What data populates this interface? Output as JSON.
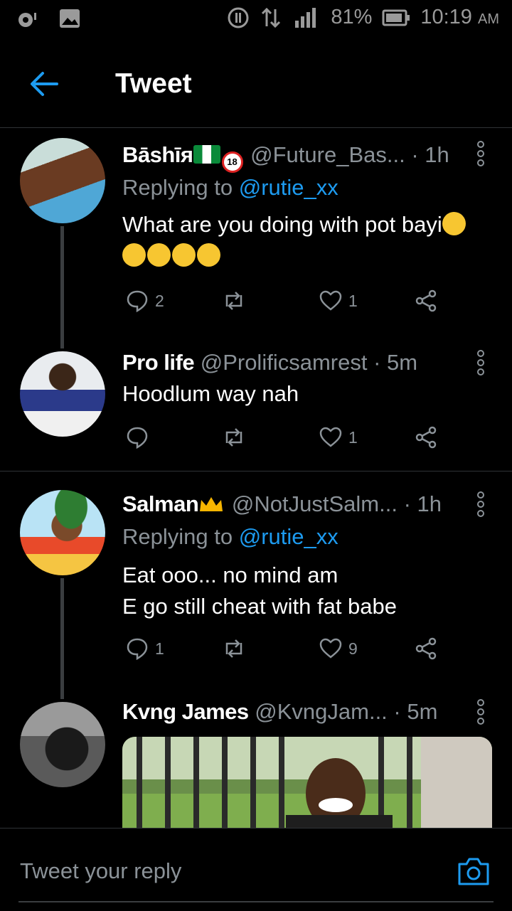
{
  "status_bar": {
    "battery": "81%",
    "time": "10:19",
    "ampm": "AM"
  },
  "header": {
    "title": "Tweet"
  },
  "tweets": [
    {
      "name": "Bāshīя",
      "handle": "@Future_Bas...",
      "time": "1h",
      "replying_label": "Replying to ",
      "replying_to": "@rutie_xx",
      "text_line1": "What are you doing with pot bayi",
      "replies": "2",
      "retweets": "",
      "likes": "1"
    },
    {
      "name": "Pro life",
      "handle": "@Prolificsamrest",
      "time": "5m",
      "text_line1": "Hoodlum way nah",
      "replies": "",
      "retweets": "",
      "likes": "1"
    },
    {
      "name": "Salman",
      "handle": "@NotJustSalm...",
      "time": "1h",
      "replying_label": "Replying to ",
      "replying_to": "@rutie_xx",
      "text_line1": "Eat ooo... no mind am",
      "text_line2": "E go still cheat with fat babe",
      "replies": "1",
      "retweets": "",
      "likes": "9"
    },
    {
      "name": "Kvng James",
      "handle": "@KvngJam...",
      "time": "5m"
    }
  ],
  "separator": "·",
  "reply_bar": {
    "placeholder": "Tweet your reply"
  },
  "icons": {
    "back": "arrow-left-icon",
    "more": "more-vertical-icon",
    "reply": "speech-bubble-icon",
    "retweet": "retweet-icon",
    "like": "heart-icon",
    "share": "share-icon",
    "camera": "camera-icon"
  },
  "colors": {
    "accent": "#1d9bf0",
    "muted": "#8b9298",
    "background": "#000000"
  }
}
